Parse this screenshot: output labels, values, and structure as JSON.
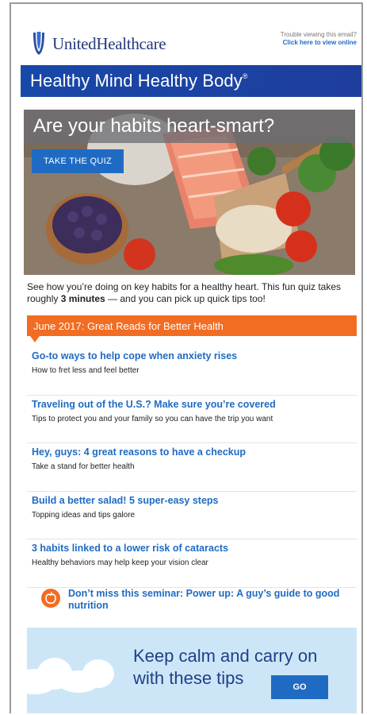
{
  "header": {
    "brand": "UnitedHealthcare",
    "trouble_text": "Trouble viewing this email?",
    "view_online": "Click here to view online"
  },
  "banner": {
    "title": "Healthy Mind Healthy Body",
    "registered": "®"
  },
  "hero": {
    "headline": "Are your habits heart-smart?",
    "quiz_button": "TAKE THE QUIZ"
  },
  "intro": {
    "text_before": "See how you’re doing on key habits for a healthy heart. This fun quiz takes roughly ",
    "emphasis": "3 minutes",
    "text_after": " — and you can pick up quick tips too!"
  },
  "section": {
    "title": "June 2017: Great Reads for Better Health"
  },
  "articles": [
    {
      "title": "Go-to ways to help cope when anxiety rises",
      "subtitle": "How to fret less and feel better"
    },
    {
      "title": "Traveling out of the U.S.? Make sure you’re covered",
      "subtitle": "Tips to protect you and your family so you can have the trip you want"
    },
    {
      "title": "Hey, guys: 4 great reasons to have a checkup",
      "subtitle": "Take a stand for better health"
    },
    {
      "title": "Build a better salad! 5 super-easy steps",
      "subtitle": "Topping ideas and tips galore"
    },
    {
      "title": "3 habits linked to a lower risk of cataracts",
      "subtitle": "Healthy behaviors may help keep your vision clear"
    }
  ],
  "seminar": {
    "text": "Don’t miss this seminar: Power up: A guy’s guide to good nutrition"
  },
  "calm": {
    "line1": "Keep calm and carry on",
    "line2": "with these tips",
    "go_button": "GO"
  },
  "colors": {
    "brand_blue": "#1f6bc3",
    "banner_blue": "#1848a8",
    "accent_orange": "#f26c22",
    "sky": "#cde6f7"
  }
}
